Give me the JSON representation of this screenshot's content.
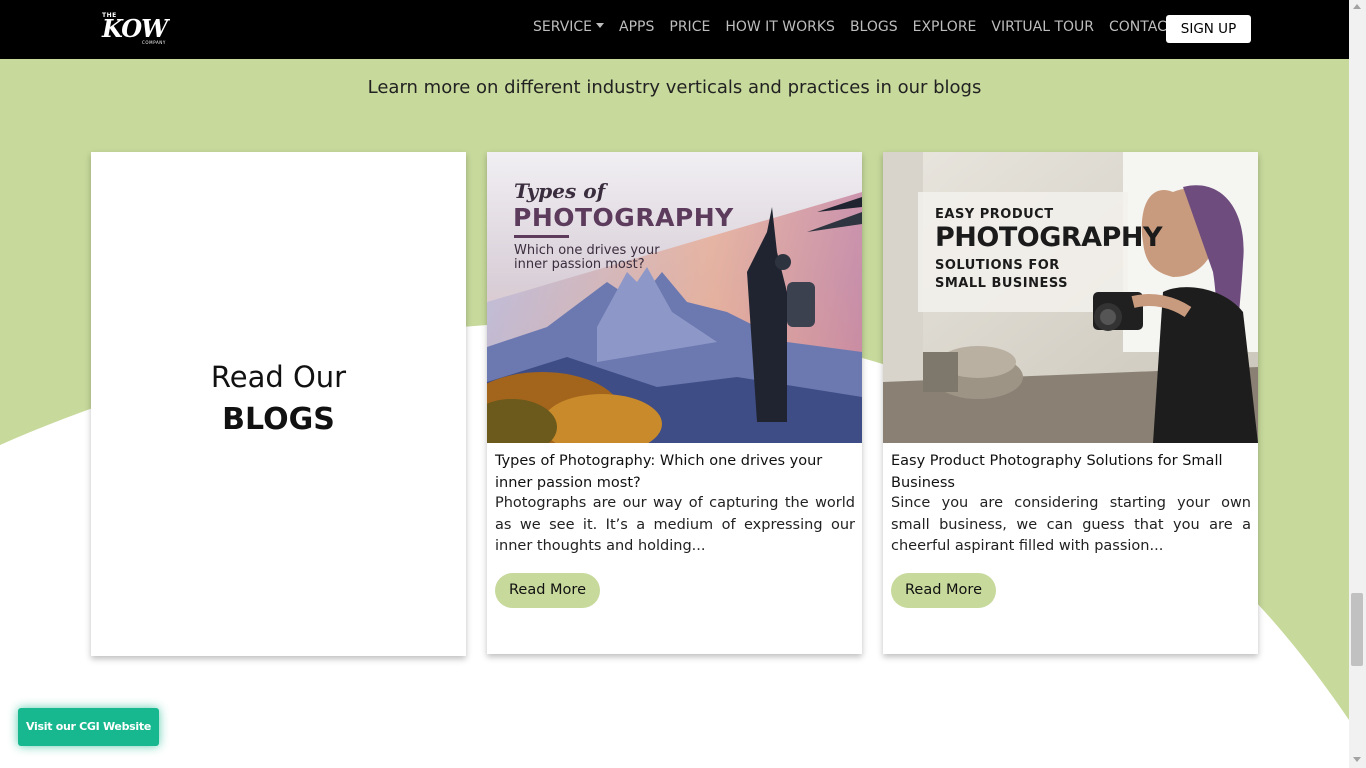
{
  "nav": {
    "logo_the": "THE",
    "logo_kow": "KOW",
    "logo_company": "COMPANY",
    "items": [
      {
        "label": "SERVICE",
        "dropdown": true
      },
      {
        "label": "APPS"
      },
      {
        "label": "PRICE"
      },
      {
        "label": "HOW IT WORKS"
      },
      {
        "label": "BLOGS"
      },
      {
        "label": "EXPLORE"
      },
      {
        "label": "VIRTUAL TOUR"
      },
      {
        "label": "CONTACT"
      }
    ],
    "signup_label": "SIGN UP"
  },
  "section": {
    "subtitle": "Learn more on different industry verticals and practices in our blogs"
  },
  "intro_card": {
    "line1": "Read Our",
    "line2": "BLOGS"
  },
  "blogs": [
    {
      "image_lines": [
        "Types of",
        "PHOTOGRAPHY",
        "Which one drives your",
        "inner passion most?"
      ],
      "title": "Types of Photography: Which one drives your inner passion most?",
      "excerpt": "Photographs are our way of capturing the world as we see it. It’s a medium of expressing our inner thoughts and holding...",
      "button": "Read More"
    },
    {
      "image_lines": [
        "EASY PRODUCT",
        "PHOTOGRAPHY",
        "SOLUTIONS FOR",
        "SMALL BUSINESS"
      ],
      "title": "Easy Product Photography Solutions for Small Business",
      "excerpt": "Since you are considering starting your own small business, we can guess that you are a cheerful aspirant filled with passion...",
      "button": "Read More"
    }
  ],
  "cgi_button": "Visit our CGI Website",
  "colors": {
    "accent_green": "#c7d99b",
    "cgi_teal": "#17b88f",
    "navbar_bg": "#000000"
  }
}
